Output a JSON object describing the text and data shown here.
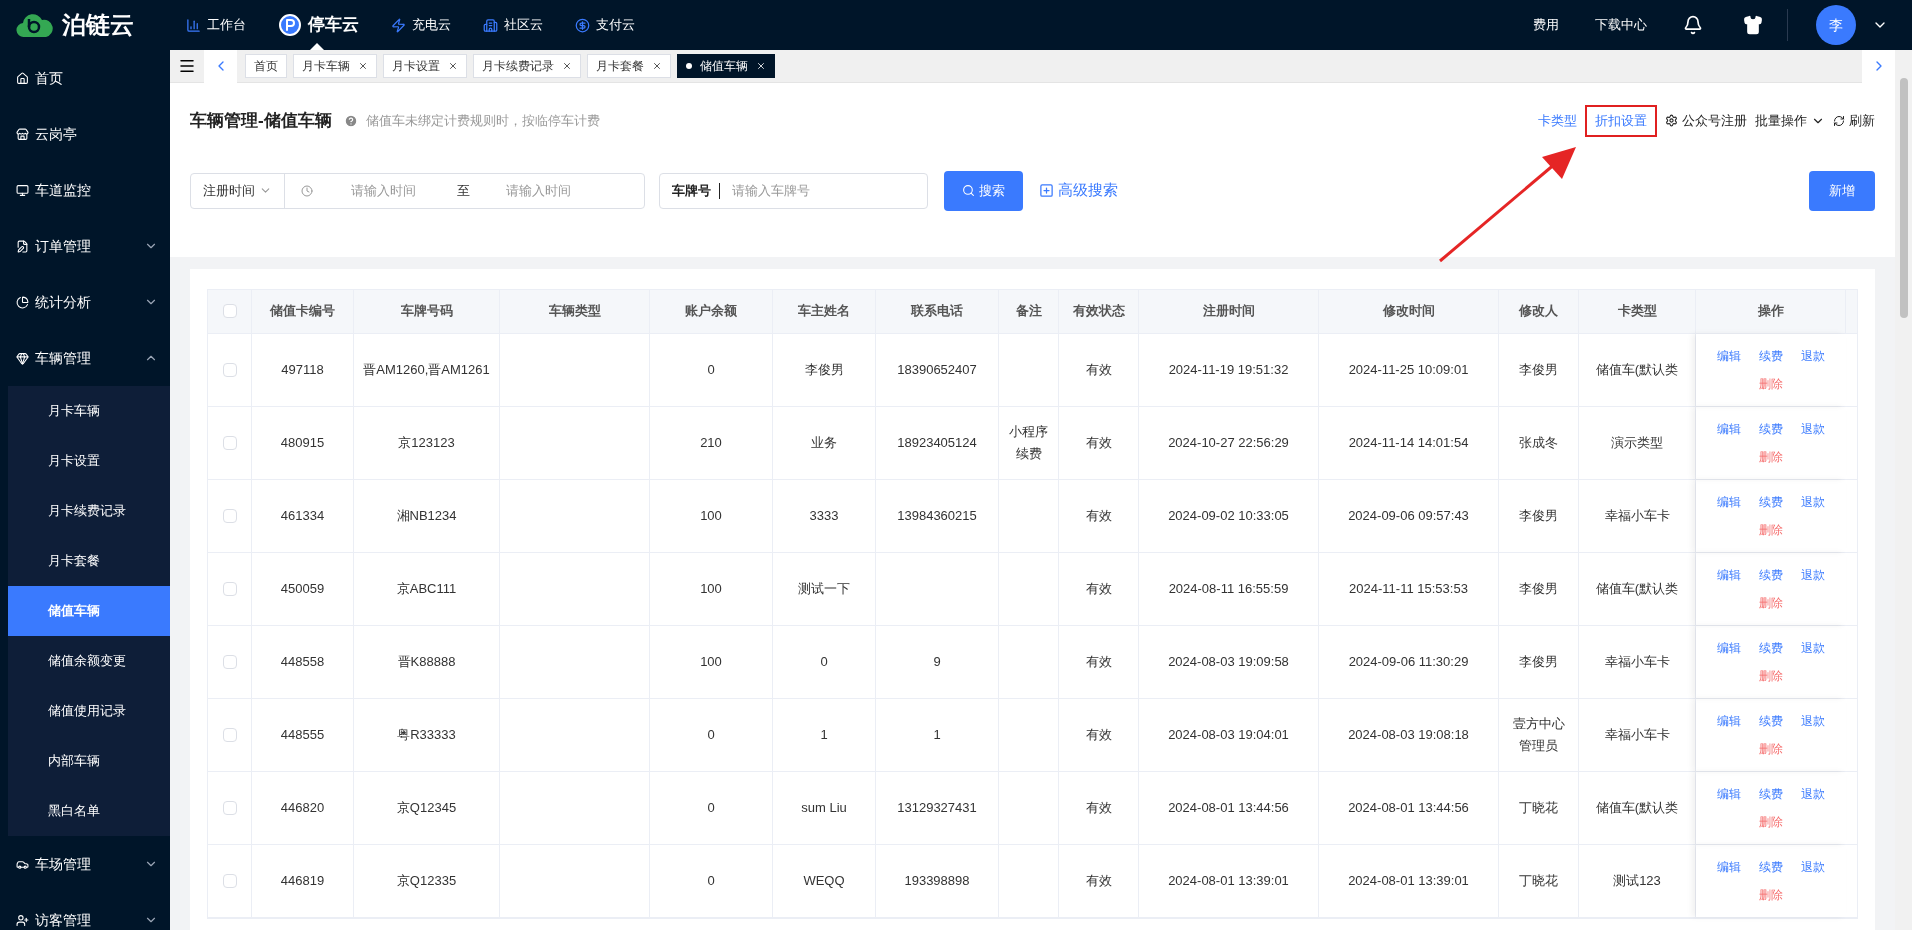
{
  "brand": {
    "name": "泊链云"
  },
  "top_nav": [
    {
      "label": "工作台",
      "selected": false
    },
    {
      "label": "停车云",
      "selected": true
    },
    {
      "label": "充电云",
      "selected": false
    },
    {
      "label": "社区云",
      "selected": false
    },
    {
      "label": "支付云",
      "selected": false
    }
  ],
  "top_right": {
    "links": [
      "费用",
      "下载中心"
    ],
    "avatar": "李"
  },
  "sidebar": {
    "items": [
      {
        "label": "首页",
        "kind": "link"
      },
      {
        "label": "云岗亭",
        "kind": "link"
      },
      {
        "label": "车道监控",
        "kind": "link"
      },
      {
        "label": "订单管理",
        "kind": "group",
        "expanded": false
      },
      {
        "label": "统计分析",
        "kind": "group",
        "expanded": false
      },
      {
        "label": "车辆管理",
        "kind": "group",
        "expanded": true,
        "children": [
          {
            "label": "月卡车辆",
            "selected": false
          },
          {
            "label": "月卡设置",
            "selected": false
          },
          {
            "label": "月卡续费记录",
            "selected": false
          },
          {
            "label": "月卡套餐",
            "selected": false
          },
          {
            "label": "储值车辆",
            "selected": true
          },
          {
            "label": "储值余额变更",
            "selected": false
          },
          {
            "label": "储值使用记录",
            "selected": false
          },
          {
            "label": "内部车辆",
            "selected": false
          },
          {
            "label": "黑白名单",
            "selected": false
          }
        ]
      },
      {
        "label": "车场管理",
        "kind": "group",
        "expanded": false
      },
      {
        "label": "访客管理",
        "kind": "group",
        "expanded": false
      }
    ]
  },
  "tabs": [
    {
      "label": "首页",
      "closable": false,
      "selected": false
    },
    {
      "label": "月卡车辆",
      "closable": true,
      "selected": false
    },
    {
      "label": "月卡设置",
      "closable": true,
      "selected": false
    },
    {
      "label": "月卡续费记录",
      "closable": true,
      "selected": false
    },
    {
      "label": "月卡套餐",
      "closable": true,
      "selected": false
    },
    {
      "label": "储值车辆",
      "closable": true,
      "selected": true
    }
  ],
  "page": {
    "title": "车辆管理-储值车辆",
    "hint": "储值车未绑定计费规则时，按临停车计费",
    "actions": [
      {
        "label": "卡类型",
        "kind": "link",
        "highlighted": false
      },
      {
        "label": "折扣设置",
        "kind": "link",
        "highlighted": true
      },
      {
        "label": "公众号注册",
        "kind": "gear",
        "highlighted": false
      },
      {
        "label": "批量操作",
        "kind": "dropdown",
        "highlighted": false
      },
      {
        "label": "刷新",
        "kind": "refresh",
        "highlighted": false
      }
    ]
  },
  "filters": {
    "time_type": "注册时间",
    "start_placeholder": "请输入时间",
    "separator": "至",
    "end_placeholder": "请输入时间",
    "plate_label": "车牌号",
    "plate_placeholder": "请输入车牌号",
    "search_button": "搜索",
    "advanced_search": "高级搜索",
    "add_button": "新增"
  },
  "table": {
    "select_all": false,
    "columns": [
      "储值卡编号",
      "车牌号码",
      "车辆类型",
      "账户余额",
      "车主姓名",
      "联系电话",
      "备注",
      "有效状态",
      "注册时间",
      "修改时间",
      "修改人",
      "卡类型",
      "操作"
    ],
    "rows": [
      {
        "selected": false,
        "cells": [
          "497118",
          "晋AM1260,晋AM1261",
          "",
          "0",
          "李俊男",
          "18390652407",
          "",
          "有效",
          "2024-11-19 19:51:32",
          "2024-11-25 10:09:01",
          "李俊男",
          "储值车(默认类"
        ],
        "actions": [
          {
            "label": "编辑",
            "kind": "primary"
          },
          {
            "label": "续费",
            "kind": "primary"
          },
          {
            "label": "退款",
            "kind": "primary"
          },
          {
            "label": "删除",
            "kind": "danger"
          }
        ]
      },
      {
        "selected": false,
        "cells": [
          "480915",
          "京123123",
          "",
          "210",
          "业务",
          "18923405124",
          "小程序续费",
          "有效",
          "2024-10-27 22:56:29",
          "2024-11-14 14:01:54",
          "张成冬",
          "演示类型"
        ],
        "actions": [
          {
            "label": "编辑",
            "kind": "primary"
          },
          {
            "label": "续费",
            "kind": "primary"
          },
          {
            "label": "退款",
            "kind": "primary"
          },
          {
            "label": "删除",
            "kind": "danger"
          }
        ]
      },
      {
        "selected": false,
        "cells": [
          "461334",
          "湘NB1234",
          "",
          "100",
          "3333",
          "13984360215",
          "",
          "有效",
          "2024-09-02 10:33:05",
          "2024-09-06 09:57:43",
          "李俊男",
          "幸福小车卡"
        ],
        "actions": [
          {
            "label": "编辑",
            "kind": "primary"
          },
          {
            "label": "续费",
            "kind": "primary"
          },
          {
            "label": "退款",
            "kind": "primary"
          },
          {
            "label": "删除",
            "kind": "danger"
          }
        ]
      },
      {
        "selected": false,
        "cells": [
          "450059",
          "京ABC111",
          "",
          "100",
          "测试一下",
          "",
          "",
          "有效",
          "2024-08-11 16:55:59",
          "2024-11-11 15:53:53",
          "李俊男",
          "储值车(默认类"
        ],
        "actions": [
          {
            "label": "编辑",
            "kind": "primary"
          },
          {
            "label": "续费",
            "kind": "primary"
          },
          {
            "label": "退款",
            "kind": "primary"
          },
          {
            "label": "删除",
            "kind": "danger"
          }
        ]
      },
      {
        "selected": false,
        "cells": [
          "448558",
          "晋K88888",
          "",
          "100",
          "0",
          "9",
          "",
          "有效",
          "2024-08-03 19:09:58",
          "2024-09-06 11:30:29",
          "李俊男",
          "幸福小车卡"
        ],
        "actions": [
          {
            "label": "编辑",
            "kind": "primary"
          },
          {
            "label": "续费",
            "kind": "primary"
          },
          {
            "label": "退款",
            "kind": "primary"
          },
          {
            "label": "删除",
            "kind": "danger"
          }
        ]
      },
      {
        "selected": false,
        "cells": [
          "448555",
          "粤R33333",
          "",
          "0",
          "1",
          "1",
          "",
          "有效",
          "2024-08-03 19:04:01",
          "2024-08-03 19:08:18",
          "壹方中心管理员",
          "幸福小车卡"
        ],
        "actions": [
          {
            "label": "编辑",
            "kind": "primary"
          },
          {
            "label": "续费",
            "kind": "primary"
          },
          {
            "label": "退款",
            "kind": "primary"
          },
          {
            "label": "删除",
            "kind": "danger"
          }
        ]
      },
      {
        "selected": false,
        "cells": [
          "446820",
          "京Q12345",
          "",
          "0",
          "sum Liu",
          "13129327431",
          "",
          "有效",
          "2024-08-01 13:44:56",
          "2024-08-01 13:44:56",
          "丁晓花",
          "储值车(默认类"
        ],
        "actions": [
          {
            "label": "编辑",
            "kind": "primary"
          },
          {
            "label": "续费",
            "kind": "primary"
          },
          {
            "label": "退款",
            "kind": "primary"
          },
          {
            "label": "删除",
            "kind": "danger"
          }
        ]
      },
      {
        "selected": false,
        "cells": [
          "446819",
          "京Q12335",
          "",
          "0",
          "WEQQ",
          "193398898",
          "",
          "有效",
          "2024-08-01 13:39:01",
          "2024-08-01 13:39:01",
          "丁晓花",
          "测试123"
        ],
        "actions": [
          {
            "label": "编辑",
            "kind": "primary"
          },
          {
            "label": "续费",
            "kind": "primary"
          },
          {
            "label": "退款",
            "kind": "primary"
          },
          {
            "label": "删除",
            "kind": "danger"
          }
        ]
      }
    ]
  }
}
